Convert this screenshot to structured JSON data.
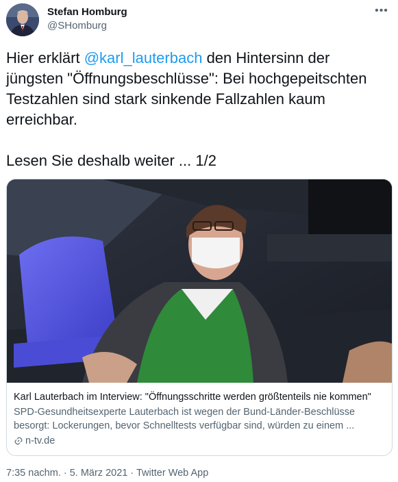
{
  "author": {
    "name": "Stefan Homburg",
    "handle": "@SHomburg"
  },
  "tweet": {
    "text_before": "Hier erklärt ",
    "mention": "@karl_lauterbach",
    "text_after": " den Hintersinn der jüngsten \"Öffnungsbeschlüsse\": Bei hochgepeitschten Testzahlen sind stark sinkende Fallzahlen kaum erreichbar.",
    "line2": "Lesen Sie deshalb weiter ... 1/2"
  },
  "card": {
    "title": "Karl Lauterbach im Interview: \"Öffnungsschritte werden größtenteils nie kommen\"",
    "description": "SPD-Gesundheitsexperte Lauterbach ist wegen der Bund-Länder-Beschlüsse besorgt: Lockerungen, bevor Schnelltests verfügbar sind, würden zu einem ...",
    "domain": "n-tv.de"
  },
  "meta": {
    "time": "7:35 nachm.",
    "sep1": " · ",
    "date": "5. März 2021",
    "sep2": " · ",
    "source": "Twitter Web App"
  },
  "icons": {
    "more": "more-horizontal-icon",
    "link": "link-icon"
  },
  "colors": {
    "link": "#1d9bf0",
    "secondary_text": "#536471",
    "border": "#cfd9de"
  }
}
